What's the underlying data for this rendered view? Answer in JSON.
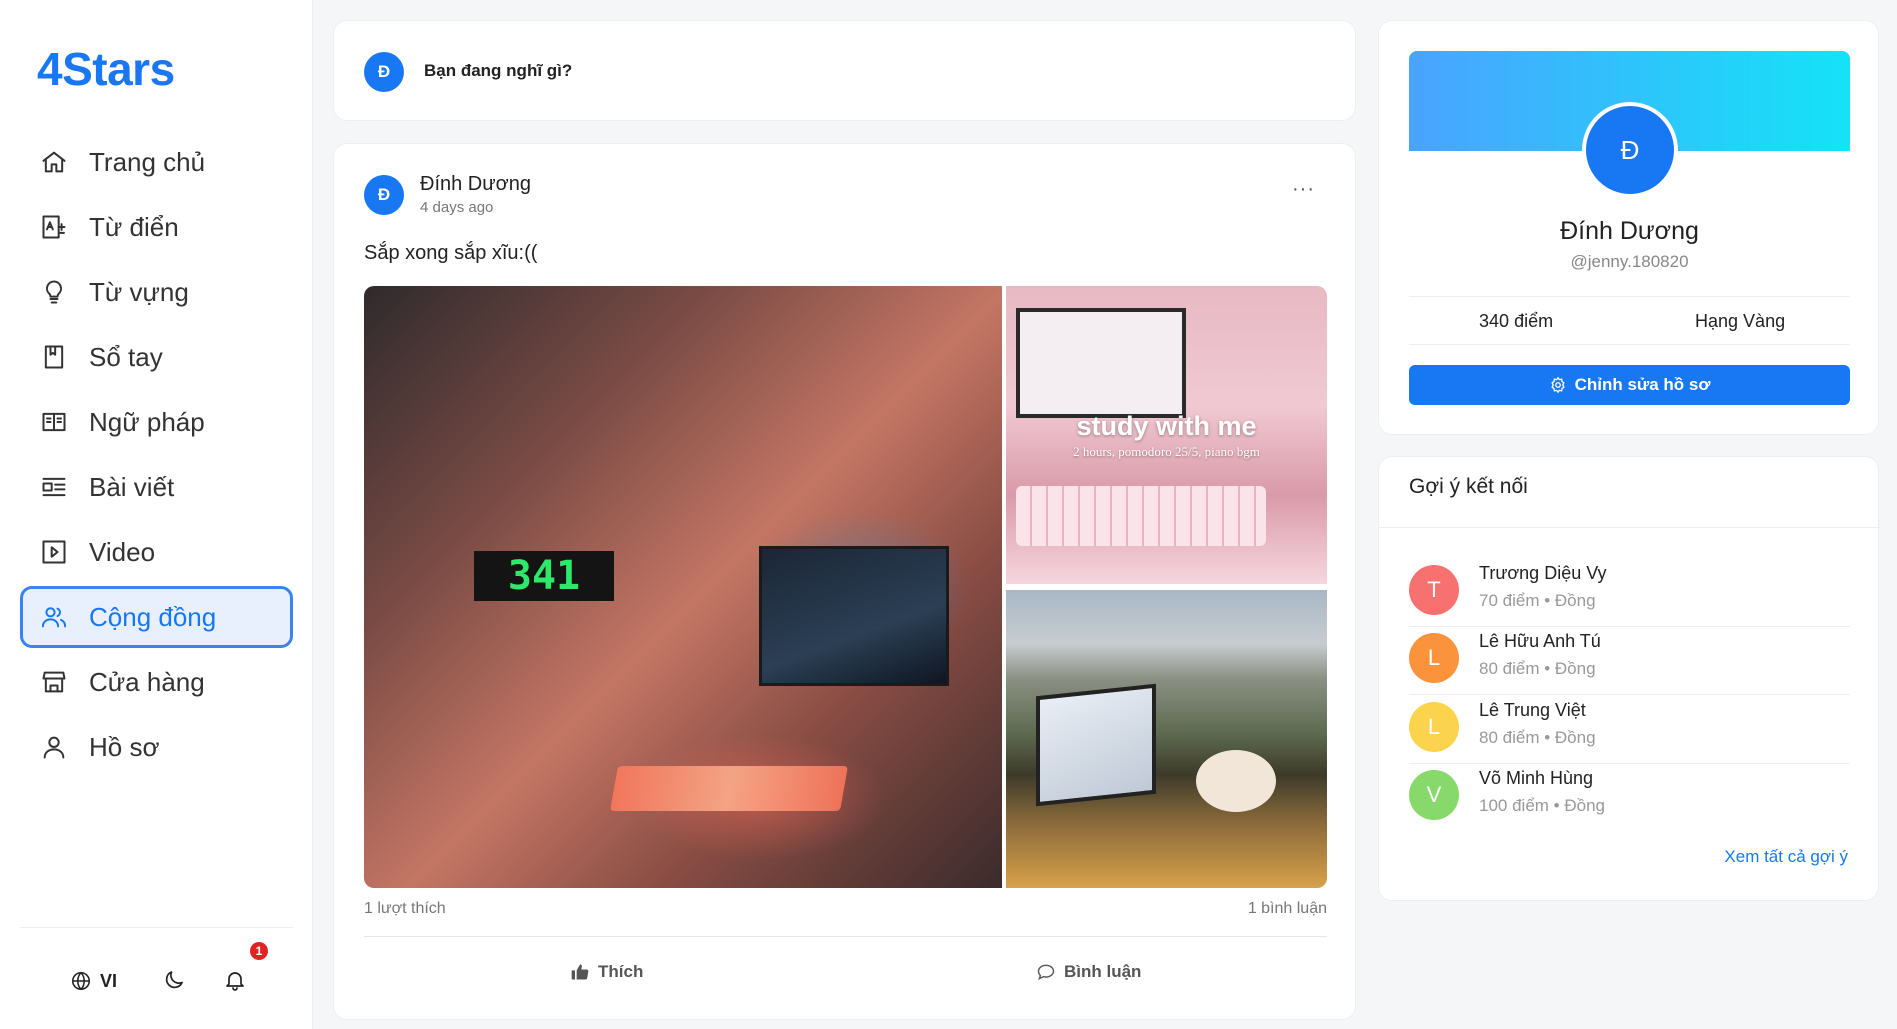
{
  "app": {
    "logo": "4Stars"
  },
  "sidebar": {
    "items": [
      {
        "label": "Trang chủ",
        "icon": "home-icon"
      },
      {
        "label": "Từ điển",
        "icon": "dictionary-icon"
      },
      {
        "label": "Từ vựng",
        "icon": "lightbulb-icon"
      },
      {
        "label": "Sổ tay",
        "icon": "notebook-icon"
      },
      {
        "label": "Ngữ pháp",
        "icon": "book-open-icon"
      },
      {
        "label": "Bài viết",
        "icon": "article-icon"
      },
      {
        "label": "Video",
        "icon": "video-icon"
      },
      {
        "label": "Cộng đồng",
        "icon": "community-icon",
        "active": true
      },
      {
        "label": "Cửa hàng",
        "icon": "store-icon"
      },
      {
        "label": "Hồ sơ",
        "icon": "user-icon"
      }
    ],
    "footer": {
      "language": "VI",
      "notification_count": "1"
    }
  },
  "composer": {
    "avatar_initial": "Đ",
    "prompt": "Bạn đang nghĩ gì?"
  },
  "post": {
    "avatar_initial": "Đ",
    "author": "Đính Dương",
    "time": "4 days ago",
    "more": "···",
    "content": "Sắp xong sắp xĩu:((",
    "images": {
      "clock_text": "341",
      "caption_title": "study with me",
      "caption_sub": "2 hours, pomodoro 25/5, piano bgm"
    },
    "likes": "1 lượt thích",
    "comments": "1 bình luận",
    "like_label": "Thích",
    "comment_label": "Bình luận"
  },
  "profile": {
    "avatar_initial": "Đ",
    "name": "Đính Dương",
    "handle": "@jenny.180820",
    "points_value": "340",
    "points_unit": "điểm",
    "rank_label": "Hạng",
    "rank_value": "Vàng",
    "edit_label": "Chỉnh sửa hồ sơ"
  },
  "suggestions": {
    "title": "Gợi ý kết nối",
    "items": [
      {
        "initial": "T",
        "name": "Trương Diệu Vy",
        "sub": "70 điểm • Đồng",
        "color": "#f87171"
      },
      {
        "initial": "L",
        "name": "Lê Hữu Anh Tú",
        "sub": "80 điểm • Đồng",
        "color": "#fb923c"
      },
      {
        "initial": "L",
        "name": "Lê Trung Việt",
        "sub": "80 điểm • Đồng",
        "color": "#fcd34d"
      },
      {
        "initial": "V",
        "name": "Võ Minh Hùng",
        "sub": "100 điểm • Đồng",
        "color": "#86d96a"
      }
    ],
    "see_all": "Xem tất cả gợi ý"
  },
  "colors": {
    "accent": "#1877f2",
    "badge": "#e02424"
  }
}
